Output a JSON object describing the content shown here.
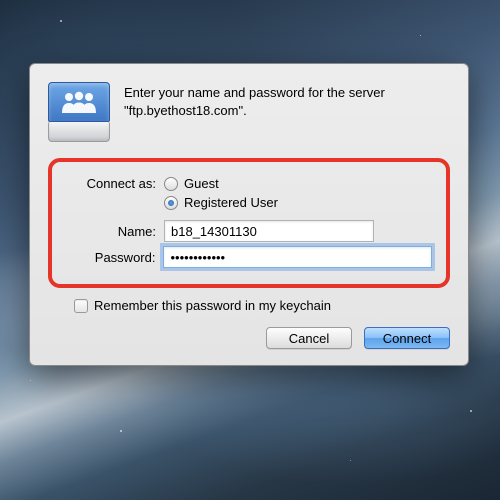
{
  "prompt_line1": "Enter your name and password for the server",
  "prompt_line2": "\"ftp.byethost18.com\".",
  "connect_as_label": "Connect as:",
  "radio_guest_label": "Guest",
  "radio_registered_label": "Registered User",
  "name_label": "Name:",
  "name_value": "b18_14301130",
  "password_label": "Password:",
  "password_value": "••••••••••••",
  "remember_label": "Remember this password in my keychain",
  "cancel_label": "Cancel",
  "connect_label": "Connect",
  "connect_as_selected": "registered"
}
